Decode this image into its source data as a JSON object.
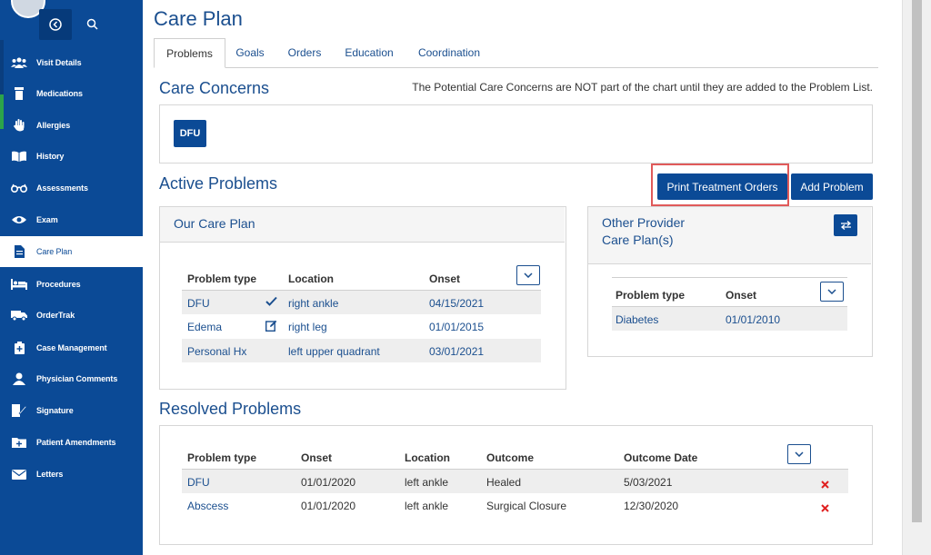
{
  "sidebar": {
    "items": [
      {
        "label": "Visit Details",
        "icon": "users-icon"
      },
      {
        "label": "Medications",
        "icon": "medication-icon"
      },
      {
        "label": "Allergies",
        "icon": "hand-icon"
      },
      {
        "label": "History",
        "icon": "book-icon"
      },
      {
        "label": "Assessments",
        "icon": "glasses-icon"
      },
      {
        "label": "Exam",
        "icon": "eye-icon"
      },
      {
        "label": "Care Plan",
        "icon": "document-icon"
      },
      {
        "label": "Procedures",
        "icon": "bed-icon"
      },
      {
        "label": "OrderTrak",
        "icon": "truck-icon"
      },
      {
        "label": "Case Management",
        "icon": "briefcase-icon"
      },
      {
        "label": "Physician Comments",
        "icon": "user-icon"
      },
      {
        "label": "Signature",
        "icon": "signature-icon"
      },
      {
        "label": "Patient Amendments",
        "icon": "folder-plus-icon"
      },
      {
        "label": "Letters",
        "icon": "envelope-icon"
      }
    ],
    "active": "Care Plan"
  },
  "page": {
    "title": "Care Plan"
  },
  "tabs": [
    {
      "label": "Problems",
      "active": true
    },
    {
      "label": "Goals"
    },
    {
      "label": "Orders"
    },
    {
      "label": "Education"
    },
    {
      "label": "Coordination"
    }
  ],
  "care_concerns": {
    "title": "Care Concerns",
    "note": "The Potential Care Concerns are NOT part of the chart until they are added to the Problem List.",
    "chips": [
      "DFU"
    ]
  },
  "active_problems": {
    "title": "Active Problems",
    "print_button": "Print Treatment Orders",
    "add_button": "Add Problem",
    "our_care_plan": {
      "title": "Our Care Plan",
      "headers": [
        "Problem type",
        "Location",
        "Onset"
      ],
      "rows": [
        {
          "problem": "DFU",
          "status_icon": "check-icon",
          "location": "right ankle",
          "onset": "04/15/2021"
        },
        {
          "problem": "Edema",
          "status_icon": "edit-icon",
          "location": "right leg",
          "onset": "01/01/2015"
        },
        {
          "problem": "Personal Hx",
          "status_icon": "",
          "location": "left upper quadrant",
          "onset": "03/01/2021"
        }
      ]
    },
    "other_provider": {
      "title_line1": "Other Provider",
      "title_line2": "Care Plan(s)",
      "headers": [
        "Problem type",
        "Onset"
      ],
      "rows": [
        {
          "problem": "Diabetes",
          "onset": "01/01/2010"
        }
      ]
    }
  },
  "resolved_problems": {
    "title": "Resolved Problems",
    "headers": [
      "Problem type",
      "Onset",
      "Location",
      "Outcome",
      "Outcome Date"
    ],
    "rows": [
      {
        "problem": "DFU",
        "onset": "01/01/2020",
        "location": "left ankle",
        "outcome": "Healed",
        "outcome_date": "5/03/2021"
      },
      {
        "problem": "Abscess",
        "onset": "01/01/2020",
        "location": "left ankle",
        "outcome": "Surgical Closure",
        "outcome_date": "12/30/2020"
      }
    ]
  },
  "colors": {
    "brand": "#0b4a96",
    "link": "#1b4f8f",
    "delete": "#e02020",
    "highlight": "#e05a5a"
  }
}
